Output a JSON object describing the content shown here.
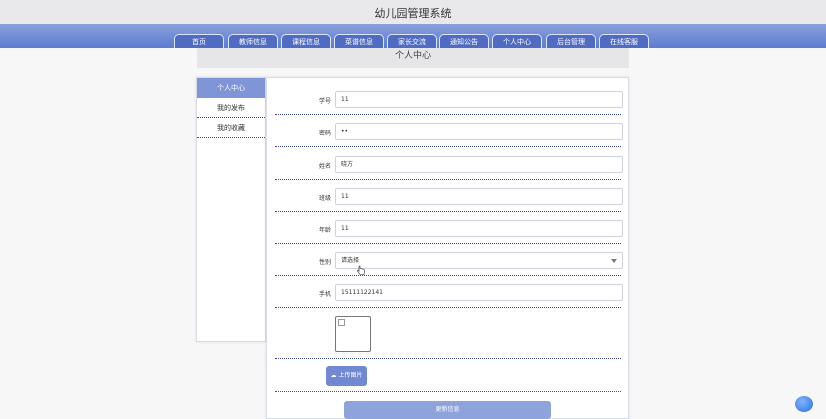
{
  "app": {
    "title": "幼儿园管理系统"
  },
  "nav": [
    {
      "label": "首页"
    },
    {
      "label": "教师信息"
    },
    {
      "label": "课程信息"
    },
    {
      "label": "菜谱信息"
    },
    {
      "label": "家长交流"
    },
    {
      "label": "通知公告"
    },
    {
      "label": "个人中心"
    },
    {
      "label": "后台管理"
    },
    {
      "label": "在线客服"
    }
  ],
  "page": {
    "title": "个人中心"
  },
  "sidebar": {
    "items": [
      {
        "label": "个人中心",
        "active": true
      },
      {
        "label": "我的发布"
      },
      {
        "label": "我的收藏"
      }
    ]
  },
  "form": {
    "student_id": {
      "label": "学号",
      "value": "11"
    },
    "password": {
      "label": "密码",
      "value": "••"
    },
    "name": {
      "label": "姓名",
      "value": "晓方"
    },
    "class": {
      "label": "班级",
      "value": "11"
    },
    "age": {
      "label": "年龄",
      "value": "11"
    },
    "gender": {
      "label": "性别",
      "value": "请选择"
    },
    "phone": {
      "label": "手机",
      "value": "15111122141"
    },
    "upload_label": "上传图片",
    "submit_label": "更新信息"
  },
  "colors": {
    "nav": "#5d7bd1",
    "accent": "#7189d4",
    "divider": "#3a4a9a"
  }
}
